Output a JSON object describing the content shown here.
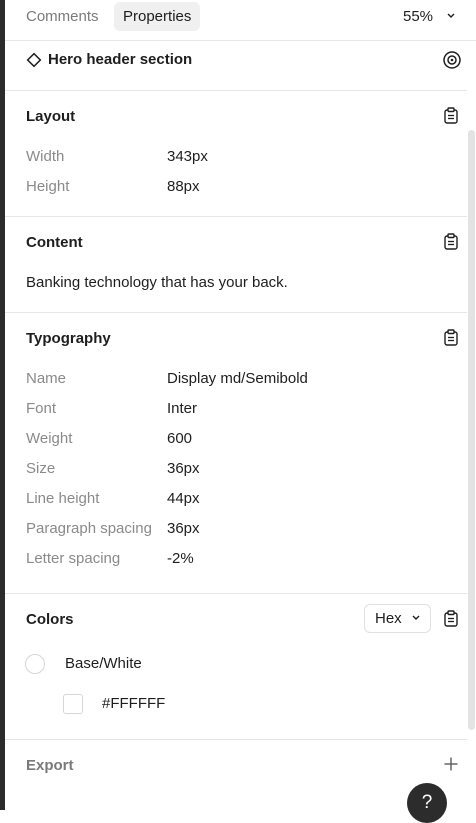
{
  "tabs": {
    "comments": "Comments",
    "properties": "Properties"
  },
  "zoom": "55%",
  "layer": {
    "name": "Hero header section"
  },
  "layout": {
    "title": "Layout",
    "rows": [
      {
        "label": "Width",
        "value": "343px"
      },
      {
        "label": "Height",
        "value": "88px"
      }
    ]
  },
  "content": {
    "title": "Content",
    "text": "Banking technology that has your back."
  },
  "typography": {
    "title": "Typography",
    "rows": [
      {
        "label": "Name",
        "value": "Display md/Semibold"
      },
      {
        "label": "Font",
        "value": "Inter"
      },
      {
        "label": "Weight",
        "value": "600"
      },
      {
        "label": "Size",
        "value": "36px"
      },
      {
        "label": "Line height",
        "value": "44px"
      },
      {
        "label": "Paragraph spacing",
        "value": "36px"
      },
      {
        "label": "Letter spacing",
        "value": "-2%"
      }
    ]
  },
  "colors": {
    "title": "Colors",
    "format": "Hex",
    "items": [
      {
        "name": "Base/White",
        "hex": "#FFFFFF"
      }
    ]
  },
  "export": {
    "title": "Export"
  },
  "help": "?",
  "icons": {
    "layer": "diamond-icon",
    "inspect": "target-icon",
    "copy": "clipboard-icon",
    "add": "plus-icon",
    "dropdown": "chevron-down-icon"
  },
  "theme": {
    "accent": "#2c2c2c",
    "muted_text": "#8a8a8a",
    "border": "#e6e6e6"
  }
}
